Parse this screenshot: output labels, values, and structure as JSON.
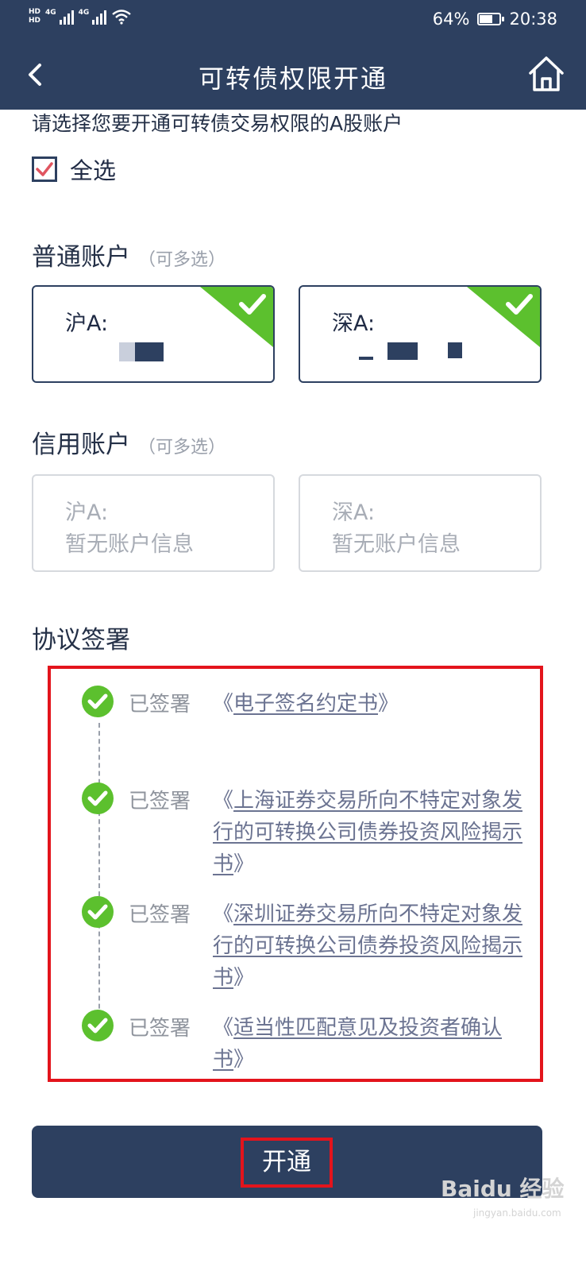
{
  "status_bar": {
    "network_1": "4G",
    "network_2": "4G",
    "battery_percent": "64%",
    "battery_level": 0.64,
    "time": "20:38",
    "hd_1": "HD",
    "hd_2": "HD"
  },
  "header": {
    "title": "可转债权限开通",
    "back_icon": "chevron-left-icon",
    "home_icon": "home-icon"
  },
  "prompt": "请选择您要开通可转债交易权限的A股账户",
  "select_all": {
    "label": "全选",
    "checked": true
  },
  "normal_accounts": {
    "title": "普通账户",
    "hint": "（可多选）",
    "cards": [
      {
        "label": "沪A:",
        "selected": true
      },
      {
        "label": "深A:",
        "selected": true
      }
    ]
  },
  "credit_accounts": {
    "title": "信用账户",
    "hint": "（可多选）",
    "cards": [
      {
        "label": "沪A:",
        "value": "暂无账户信息"
      },
      {
        "label": "深A:",
        "value": "暂无账户信息"
      }
    ]
  },
  "agreements": {
    "title": "协议签署",
    "items": [
      {
        "status": "已签署",
        "open": "《",
        "doc": "电子签名约定书",
        "close": "》"
      },
      {
        "status": "已签署",
        "open": "《",
        "doc": "上海证券交易所向不特定对象发行的可转换公司债券投资风险揭示书",
        "close": "》"
      },
      {
        "status": "已签署",
        "open": "《",
        "doc": "深圳证券交易所向不特定对象发行的可转换公司债券投资风险揭示书",
        "close": "》"
      },
      {
        "status": "已签署",
        "open": "《",
        "doc": "适当性匹配意见及投资者确认书",
        "close": "》"
      }
    ]
  },
  "submit_label": "开通",
  "watermark": {
    "brand": "Baidu 经验",
    "url": "jingyan.baidu.com"
  },
  "colors": {
    "primary": "#2d4060",
    "check_green": "#5cc02e",
    "highlight_red": "#e3141c",
    "checkbox_red": "#e05560"
  }
}
